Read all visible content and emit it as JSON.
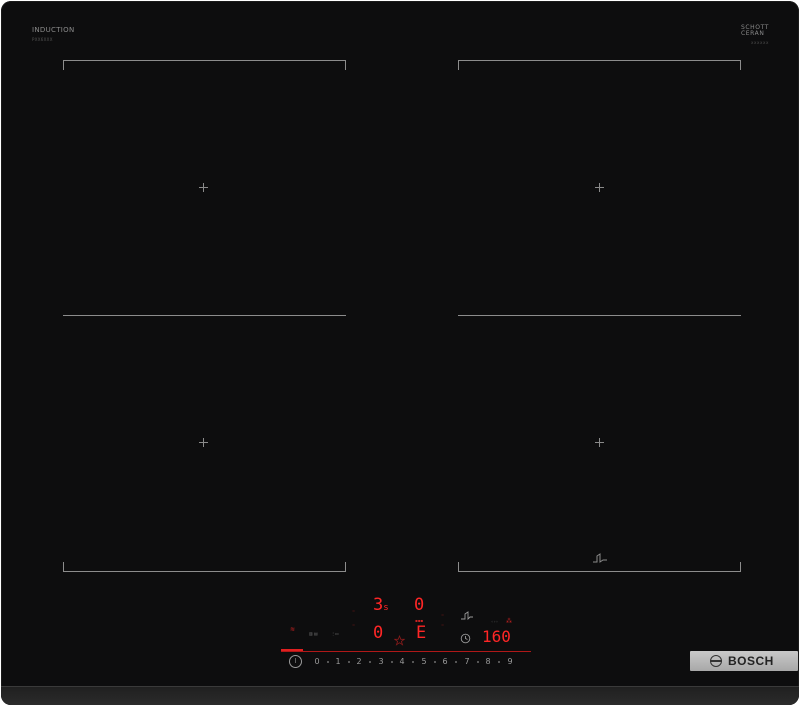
{
  "labels": {
    "induction": "INDUCTION",
    "induction_sub": "PXX6XXX",
    "schott_line1": "SCHOTT",
    "schott_line2": "CERAN",
    "schott_sub": "XXXXXX"
  },
  "displays": {
    "top_left": "3",
    "top_left_suffix": "s",
    "top_right": "0",
    "bottom_left": "0",
    "bottom_right": "E",
    "timer": "160"
  },
  "scale": [
    "0",
    "1",
    "2",
    "3",
    "4",
    "5",
    "6",
    "7",
    "8",
    "9"
  ],
  "brand": "BOSCH",
  "icons": {
    "power": "power-icon",
    "fry": "pan-fry-sensor-icon",
    "clock": "timer-icon",
    "star": "favourite-star-icon"
  },
  "colors": {
    "glass": "#0d0d0e",
    "display": "#ff2626",
    "markings": "#8c8c8c"
  }
}
